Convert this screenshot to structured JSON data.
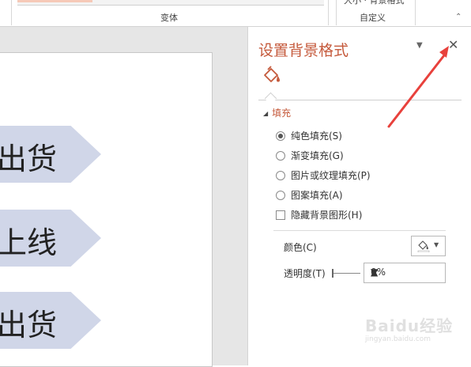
{
  "ribbon": {
    "variants_group": "变体",
    "size_button": "大小 · 背景格式",
    "custom_group": "自定义",
    "collapse_icon": "collapse-ribbon-icon"
  },
  "slide": {
    "shapes": [
      "出货",
      "上线",
      "出货"
    ],
    "shape_fill": "#d0d6e8"
  },
  "pane": {
    "title": "设置背景格式",
    "title_color": "#c55a3c",
    "menu_icon": "dropdown-arrow-icon",
    "close_icon": "close-icon",
    "tab_icon": "paint-bucket-icon",
    "section": "填充",
    "options": {
      "solid": "纯色填充(S)",
      "gradient": "渐变填充(G)",
      "picture": "图片或纹理填充(P)",
      "pattern": "图案填充(A)",
      "hide": "隐藏背景图形(H)"
    },
    "selected_option": "solid",
    "color_label": "颜色(C)",
    "transparency_label": "透明度(T)",
    "transparency_value": "0%"
  },
  "watermark": {
    "text": "Baidu经验",
    "url": "jingyan.baidu.com"
  },
  "annotation": {
    "arrow_color": "#e8413c"
  }
}
